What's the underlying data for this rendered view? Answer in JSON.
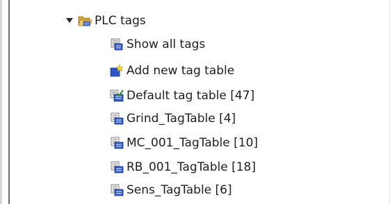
{
  "tree": {
    "folder": {
      "label": "PLC tags",
      "expanded": true,
      "icon": "folder-open-icon",
      "toggle_icon": "expand-arrow-icon"
    },
    "items": [
      {
        "label": "Show all tags",
        "icon": "show-all-tags-icon"
      },
      {
        "label": "Add new tag table",
        "icon": "add-tag-table-icon"
      },
      {
        "label": "Default tag table [47]",
        "icon": "default-tag-table-icon"
      },
      {
        "label": "Grind_TagTable [4]",
        "icon": "tag-table-icon"
      },
      {
        "label": "MC_001_TagTable [10]",
        "icon": "tag-table-icon"
      },
      {
        "label": "RB_001_TagTable [18]",
        "icon": "tag-table-icon"
      },
      {
        "label": "Sens_TagTable [6]",
        "icon": "tag-table-icon"
      }
    ]
  },
  "colors": {
    "text": "#1e1e1e",
    "folder": "#e9b949",
    "table_blue": "#2b56c7",
    "star_yellow": "#ffd21a"
  }
}
